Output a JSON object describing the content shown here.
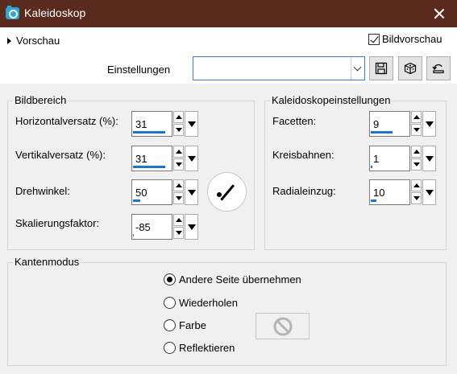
{
  "window": {
    "title": "Kaleidoskop",
    "icon": "camera-icon",
    "title_bar_color": "#5b2a1f"
  },
  "top": {
    "preview_label": "Vorschau",
    "bildvorschau_label": "Bildvorschau",
    "bildvorschau_checked": true,
    "settings_label": "Einstellungen",
    "settings_value": ""
  },
  "bildbereich": {
    "title": "Bildbereich",
    "fields": [
      {
        "label": "Horizontalversatz (%):",
        "value": "31",
        "fill": 0.81
      },
      {
        "label": "Vertikalversatz (%):",
        "value": "31",
        "fill": 0.81
      },
      {
        "label": "Drehwinkel:",
        "value": "50",
        "fill": 0.19
      },
      {
        "label": "Skalierungsfaktor:",
        "value": "-85",
        "fill": 0.02
      }
    ]
  },
  "kaleido": {
    "title": "Kaleidoskopeinstellungen",
    "fields": [
      {
        "label": "Facetten:",
        "value": "9",
        "fill": 0.55
      },
      {
        "label": "Kreisbahnen:",
        "value": "1",
        "fill": 0.04
      },
      {
        "label": "Radialeinzug:",
        "value": "10",
        "fill": 0.14
      }
    ]
  },
  "kantenmodus": {
    "title": "Kantenmodus",
    "options": [
      {
        "label": "Andere Seite übernehmen",
        "selected": true
      },
      {
        "label": "Wiederholen",
        "selected": false
      },
      {
        "label": "Farbe",
        "selected": false
      },
      {
        "label": "Reflektieren",
        "selected": false
      }
    ]
  }
}
